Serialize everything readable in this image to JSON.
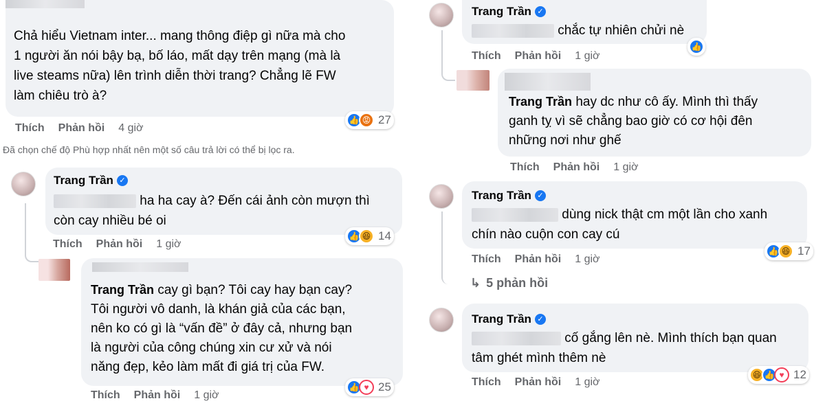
{
  "labels": {
    "like": "Thích",
    "reply": "Phản hồi"
  },
  "verified_mark": "✓",
  "reply_arrow": "↳",
  "left": {
    "c1": {
      "line1": "Chả hiểu Vietnam inter... mang thông điệp gì nữa mà cho",
      "line2": "1 người ăn nói bậy bạ, bố láo, mất dạy trên mạng (mà là",
      "line3": "live steams nữa) lên trình diễn thời trang? Chẳng lẽ FW",
      "line4": "làm chiêu trò à?",
      "time": "4 giờ",
      "reactions": [
        "like-icon",
        "angry-icon"
      ],
      "count": "27"
    },
    "filter_note": "Đã chọn chế độ Phù hợp nhất nên một số câu trả lời có thể bị lọc ra.",
    "c2": {
      "name": "Trang Trần",
      "line1": "ha ha cay à? Đến cái ảnh còn mượn thì",
      "line2": "còn cay nhiều bé oi",
      "time": "1 giờ",
      "reactions": [
        "like-icon",
        "haha-icon"
      ],
      "count": "14"
    },
    "c3": {
      "name": "Trang Trần",
      "line1": "cay gì bạn? Tôi cay hay bạn cay?",
      "line2": "Tôi người vô danh, là khán giả của các bạn,",
      "line3": "nên ko có gì là “vấn đề” ở đây cả, nhưng bạn",
      "line4": "là người của công chúng xin cư xử và nói",
      "line5": "năng đẹp, kẻo làm mất đi giá trị của FW.",
      "time": "1 giờ",
      "reactions": [
        "like-icon",
        "love-icon"
      ],
      "count": "25"
    }
  },
  "right": {
    "c1": {
      "name": "Trang Trần",
      "line1": "chắc tự nhiên chửi nè",
      "time": "1 giờ",
      "reactions": [
        "like-icon"
      ]
    },
    "c2": {
      "name": "Trang Trần",
      "line1": "hay dc như cô ấy. Mình thì thấy",
      "line2": "ganh tỵ vì sẽ chẳng bao giờ có cơ hội đên",
      "line3": "những nơi như ghế",
      "time": "1 giờ"
    },
    "c3": {
      "name": "Trang Trần",
      "line1": "dùng nick thật cm một lần cho xanh",
      "line2": "chín nào cuộn con cay cú",
      "time": "1 giờ",
      "reactions": [
        "like-icon",
        "haha-icon"
      ],
      "count": "17",
      "more_replies": "5 phản hồi"
    },
    "c4": {
      "name": "Trang Trần",
      "line1": "cố gắng lên nè. Mình thích bạn quan",
      "line2": "tâm ghét mình thêm nè",
      "time": "1 giờ",
      "reactions": [
        "haha-icon",
        "like-icon",
        "love-icon"
      ],
      "count": "12"
    }
  },
  "colors": {
    "bubble": "#f0f2f5",
    "like": "#1877f2",
    "meta": "#65676b"
  }
}
